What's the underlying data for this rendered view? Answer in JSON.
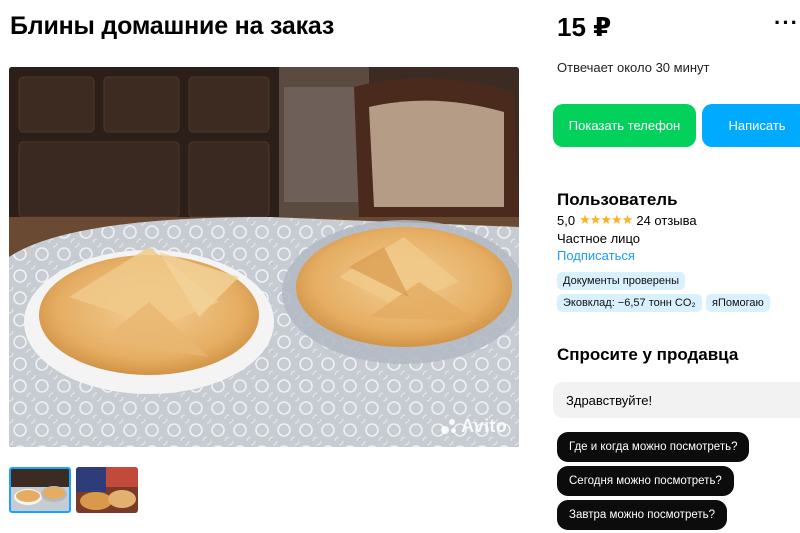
{
  "listing": {
    "title": "Блины домашние на заказ",
    "price": "15 ₽"
  },
  "menu": {
    "more_glyph": "···"
  },
  "seller_info": {
    "responds": "Отвечает около 30 минут"
  },
  "actions": {
    "show_phone": "Показать телефон",
    "write": "Написать"
  },
  "seller": {
    "name": "Пользователь",
    "rating": "5,0",
    "stars": "★★★★★",
    "reviews": "24 отзыва",
    "type": "Частное лицо",
    "subscribe": "Подписаться",
    "badges": [
      "Документы проверены",
      "Эковклад: −6,57 тонн CO₂",
      "яПомогаю"
    ]
  },
  "ask": {
    "title": "Спросите у продавца",
    "message": "Здравствуйте!",
    "quick_questions": [
      "Где и когда можно посмотреть?",
      "Сегодня можно посмотреть?",
      "Завтра можно посмотреть?"
    ]
  },
  "gallery": {
    "watermark": "Avito",
    "thumbnail_count": 2
  },
  "colors": {
    "green": "#02d15c",
    "blue": "#00aaff",
    "link": "#1a9cff",
    "star": "#ffb021",
    "badge_bg": "#d9f0ff"
  }
}
